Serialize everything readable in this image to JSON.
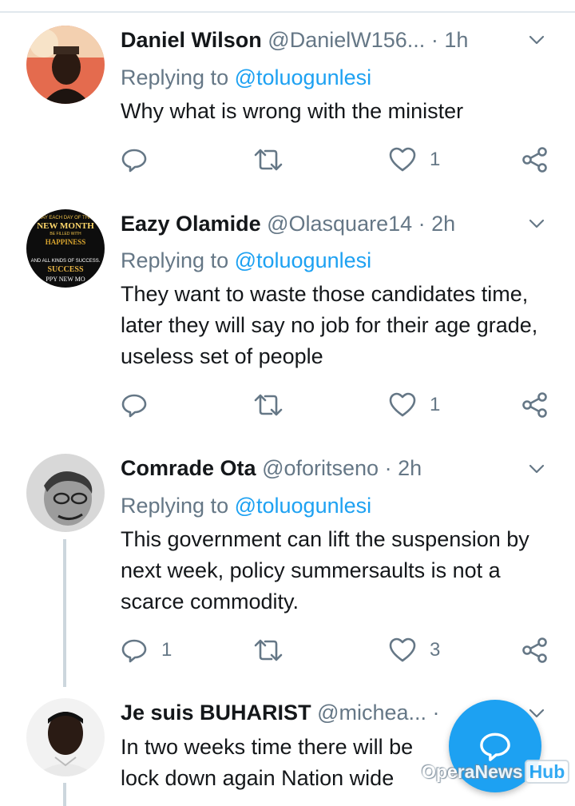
{
  "tweets": [
    {
      "name": "Daniel Wilson",
      "handle": "@DanielW156...",
      "dot": "·",
      "time": "1h",
      "replying_label": "Replying to ",
      "replying_to": "@toluogunlesi",
      "text": "Why what is wrong with the minister",
      "reply_count": "",
      "like_count": "1"
    },
    {
      "name": "Eazy Olamide",
      "handle": "@Olasquare14",
      "dot": "·",
      "time": "2h",
      "replying_label": "Replying to ",
      "replying_to": "@toluogunlesi",
      "text": "They want to waste those candidates time, later they will say no job for their age grade, useless set of people",
      "reply_count": "",
      "like_count": "1",
      "avatar_text": [
        "MAY EACH DAY OF THIS",
        "NEW MONTH",
        "BE FILLED WITH",
        "HAPPINESS",
        "AND ALL KINDS OF SUCCESS.",
        "SUCCESS",
        "PPY NEW MO"
      ]
    },
    {
      "name": "Comrade Ota",
      "handle": "@oforitseno",
      "dot": "·",
      "time": "2h",
      "replying_label": "Replying to ",
      "replying_to": "@toluogunlesi",
      "text": "This government can lift the suspension by next week, policy summersaults is not a scarce commodity.",
      "reply_count": "1",
      "like_count": "3"
    },
    {
      "name": "Je suis BUHARIST",
      "handle": "@michea...",
      "dot": "·",
      "time": "",
      "text": "In two weeks time there will be lock down again Nation wide"
    }
  ],
  "icons": {
    "reply": "reply-icon",
    "retweet": "retweet-icon",
    "like": "heart-icon",
    "share": "share-icon",
    "more": "chevron-down-icon",
    "compose": "compose-reply-icon"
  },
  "watermark": {
    "brand": "OperaNews",
    "suffix": "Hub"
  },
  "colors": {
    "accent": "#1da1f2",
    "muted": "#657786",
    "text": "#14171a",
    "divider": "#e1e8ed"
  }
}
